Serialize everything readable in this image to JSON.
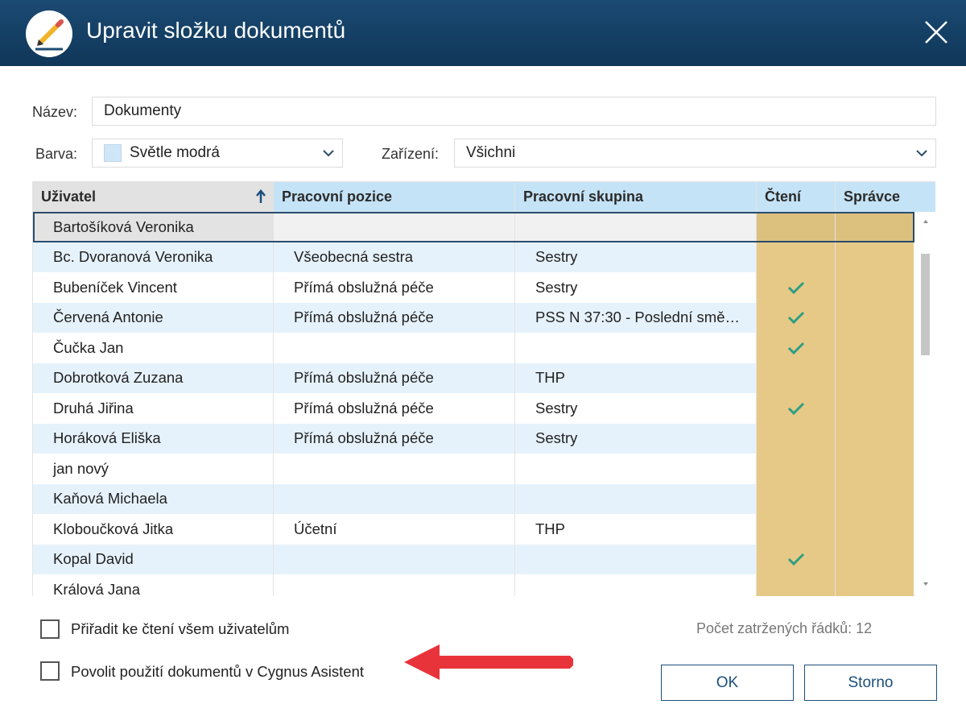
{
  "window": {
    "title": "Upravit složku dokumentů"
  },
  "form": {
    "name_label": "Název:",
    "name_value": "Dokumenty",
    "color_label": "Barva:",
    "color_value": "Světle modrá",
    "color_swatch": "#cfe6f8",
    "device_label": "Zařízení:",
    "device_value": "Všichni"
  },
  "table": {
    "columns": [
      "Uživatel",
      "Pracovní pozice",
      "Pracovní skupina",
      "Čtení",
      "Správce"
    ],
    "sort": {
      "column": "Uživatel",
      "direction": "ascending"
    },
    "rows": [
      {
        "user": "Bartošíková Veronika",
        "position": "",
        "group": "",
        "read": false,
        "admin": false,
        "selected": true
      },
      {
        "user": "Bc. Dvoranová Veronika",
        "position": "Všeobecná sestra",
        "group": "Sestry",
        "read": false,
        "admin": false
      },
      {
        "user": "Bubeníček Vincent",
        "position": "Přímá obslužná péče",
        "group": "Sestry",
        "read": true,
        "admin": false
      },
      {
        "user": "Červená Antonie",
        "position": "Přímá obslužná péče",
        "group": "PSS N 37:30 - Poslední smě…",
        "read": true,
        "admin": false
      },
      {
        "user": "Čučka Jan",
        "position": "",
        "group": "",
        "read": true,
        "admin": false
      },
      {
        "user": "Dobrotková Zuzana",
        "position": "Přímá obslužná péče",
        "group": "THP",
        "read": false,
        "admin": false
      },
      {
        "user": "Druhá Jiřina",
        "position": "Přímá obslužná péče",
        "group": "Sestry",
        "read": true,
        "admin": false
      },
      {
        "user": "Horáková Eliška",
        "position": "Přímá obslužná péče",
        "group": "Sestry",
        "read": false,
        "admin": false
      },
      {
        "user": "jan nový",
        "position": "",
        "group": "",
        "read": false,
        "admin": false
      },
      {
        "user": "Kaňová Michaela",
        "position": "",
        "group": "",
        "read": false,
        "admin": false
      },
      {
        "user": "Kloboučková Jitka",
        "position": "Účetní",
        "group": "THP",
        "read": false,
        "admin": false
      },
      {
        "user": "Kopal David",
        "position": "",
        "group": "",
        "read": true,
        "admin": false
      },
      {
        "user": "Králová Jana",
        "position": "",
        "group": "",
        "read": false,
        "admin": false
      }
    ]
  },
  "options": {
    "assign_read_all_label": "Přiřadit ke čtení všem uživatelům",
    "assign_read_all_checked": false,
    "allow_assistant_label": "Povolit použití dokumentů v Cygnus Asistent",
    "allow_assistant_checked": false
  },
  "status": {
    "checked_rows_text": "Počet zatržených řádků: 12"
  },
  "buttons": {
    "ok_label": "OK",
    "cancel_label": "Storno"
  },
  "colors": {
    "titlebar": "#173f63",
    "row_alt": "#e6f2fb",
    "header_user": "#e2e2e2",
    "header_other": "#c5e3f6",
    "permission_col": "#e6c987",
    "check": "#2e9e82",
    "annotation_arrow": "#e8333a"
  },
  "icons": {
    "app": "pencil-icon",
    "close": "close-icon",
    "dropdown": "chevron-down-icon",
    "sort": "arrow-up-icon",
    "read_check": "check-icon",
    "annotation": "arrow-left-icon"
  }
}
